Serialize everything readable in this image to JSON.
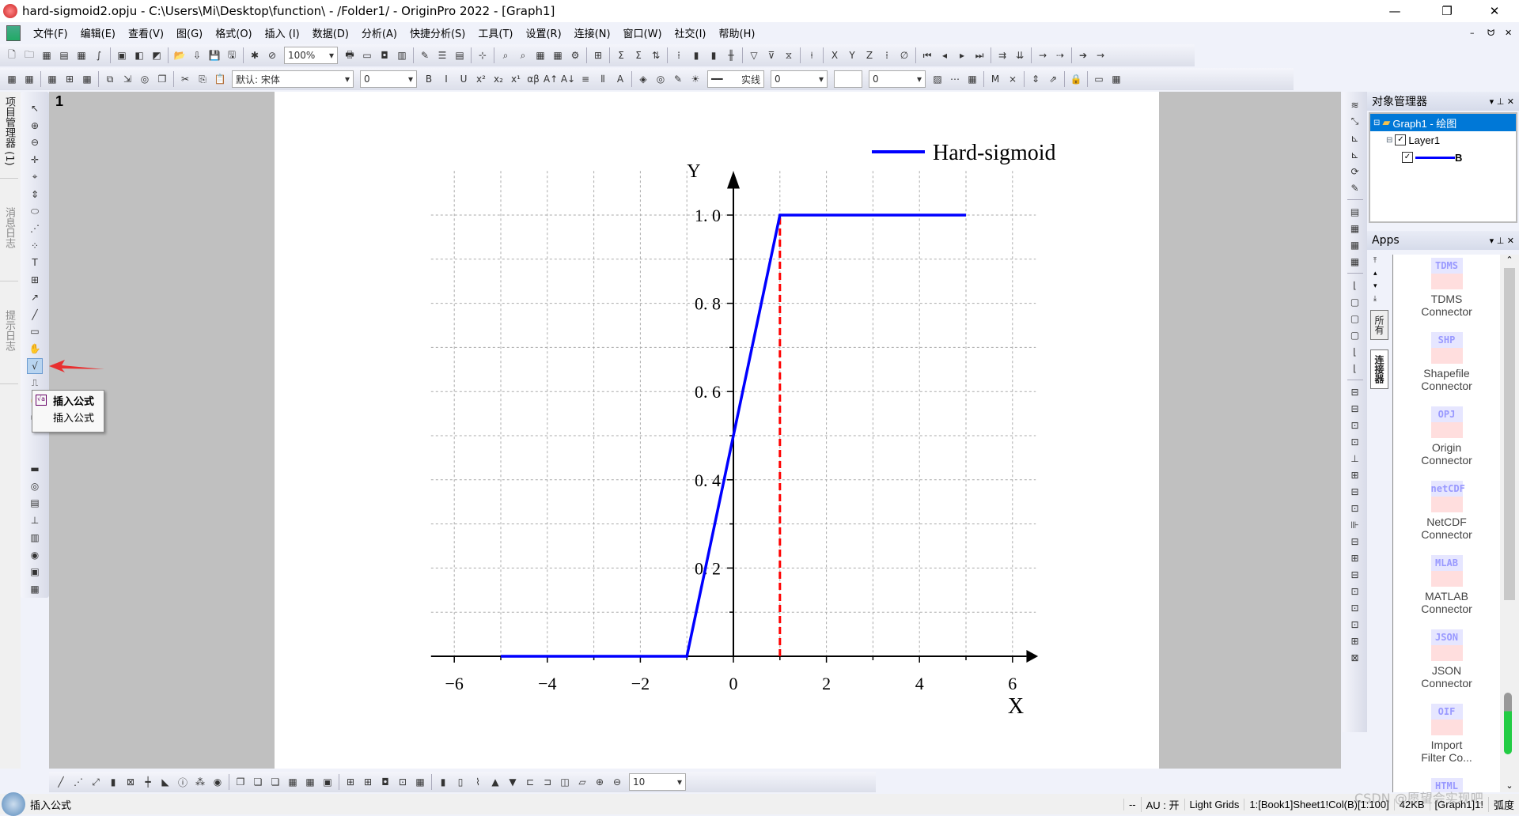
{
  "window": {
    "title": "hard-sigmoid2.opju - C:\\Users\\Mi\\Desktop\\function\\ - /Folder1/ - OriginPro 2022 - [Graph1]",
    "minimize": "—",
    "restore": "❐",
    "close": "✕"
  },
  "menu": [
    "文件(F)",
    "编辑(E)",
    "查看(V)",
    "图(G)",
    "格式(O)",
    "插入 (I)",
    "数据(D)",
    "分析(A)",
    "快捷分析(S)",
    "工具(T)",
    "设置(R)",
    "连接(N)",
    "窗口(W)",
    "社交(I)",
    "帮助(H)"
  ],
  "mdi": {
    "minimize": "–",
    "restore": "ᗢ",
    "close": "✕"
  },
  "toolbar1": {
    "zoom": "100%"
  },
  "toolbar2": {
    "font": "默认: 宋体",
    "font_size": "0",
    "line_style": "实线",
    "line_width": "0",
    "pattern": "0"
  },
  "left_tabs": [
    "项目管理器 (1)",
    "消息日志",
    "提示日志"
  ],
  "layer_number": "1",
  "tooltip": {
    "title": "插入公式",
    "subtitle": "插入公式"
  },
  "object_manager": {
    "title": "对象管理器",
    "graph": "Graph1 - 绘图",
    "layer": "Layer1",
    "plot": "B"
  },
  "apps": {
    "title": "Apps",
    "tabs": [
      "所有",
      "连接器"
    ],
    "items": [
      {
        "icon": "TDMS",
        "label1": "TDMS",
        "label2": "Connector"
      },
      {
        "icon": "SHP",
        "label1": "Shapefile",
        "label2": "Connector"
      },
      {
        "icon": "OPJ",
        "label1": "Origin",
        "label2": "Connector"
      },
      {
        "icon": "netCDF",
        "label1": "NetCDF",
        "label2": "Connector"
      },
      {
        "icon": "MLAB",
        "label1": "MATLAB",
        "label2": "Connector"
      },
      {
        "icon": "JSON",
        "label1": "JSON",
        "label2": "Connector"
      },
      {
        "icon": "OIF",
        "label1": "Import",
        "label2": "Filter Co..."
      },
      {
        "icon": "HTML",
        "label1": "",
        "label2": ""
      }
    ]
  },
  "bottom_toolbar": {
    "size": "10"
  },
  "status": {
    "message": "插入公式",
    "dash": "--",
    "au": "AU : 开",
    "grid": "Light Grids",
    "dataset": "1:[Book1]Sheet1!Col(B)[1:100]",
    "size": "42KB",
    "graph": "[Graph1]1!",
    "angle": "弧度"
  },
  "watermark": "CSDN @愿望会实现吧",
  "colors": {
    "curve": "#0000ff",
    "ref_line": "#ff0000",
    "selection": "#0078d7"
  },
  "chart_data": {
    "type": "line",
    "legend": {
      "entries": [
        "Hard-sigmoid"
      ],
      "placement": "top-right"
    },
    "xlabel": "X",
    "ylabel": "Y",
    "xlim": [
      -6.5,
      6.5
    ],
    "ylim": [
      0,
      1.1
    ],
    "xticks": [
      -6,
      -4,
      -2,
      0,
      2,
      4,
      6
    ],
    "xtick_labels": [
      "−6",
      "−4",
      "−2",
      "0",
      "2",
      "4",
      "6"
    ],
    "yticks": [
      0.2,
      0.4,
      0.6,
      0.8,
      1.0
    ],
    "ytick_labels": [
      "0. 2",
      "0. 4",
      "0. 6",
      "0. 8",
      "1. 0"
    ],
    "grid": true,
    "series": [
      {
        "name": "Hard-sigmoid",
        "color": "#0000ff",
        "x": [
          -5,
          -1,
          1,
          5
        ],
        "y": [
          0,
          0,
          1,
          1
        ]
      }
    ],
    "annotations": [
      {
        "type": "vertical-dashed-line",
        "x": 1,
        "y": [
          0,
          1
        ],
        "color": "#ff0000"
      }
    ]
  }
}
